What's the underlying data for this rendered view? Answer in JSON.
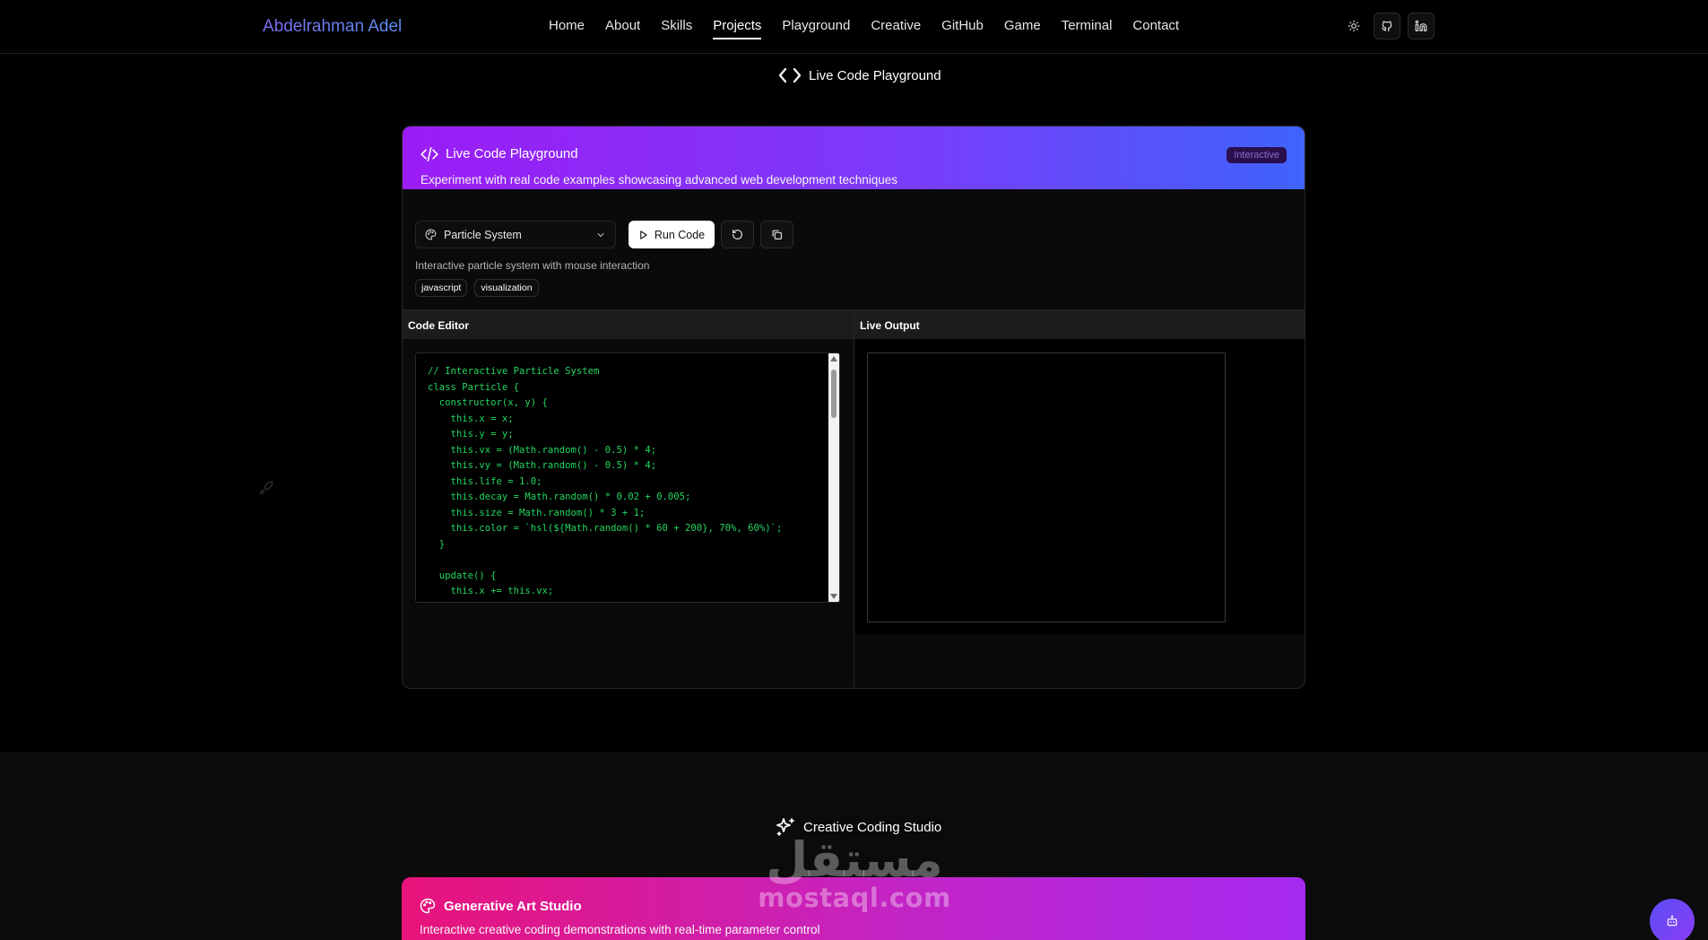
{
  "brand": "Abdelrahman Adel",
  "nav": {
    "links": [
      "Home",
      "About",
      "Skills",
      "Projects",
      "Playground",
      "Creative",
      "GitHub",
      "Game",
      "Terminal",
      "Contact"
    ],
    "active": "Projects"
  },
  "icons": {
    "theme": "sun-icon",
    "github": "github-icon",
    "linkedin": "linkedin-icon"
  },
  "section_heading": "Live Code Playground",
  "playground": {
    "title": "Live Code Playground",
    "subtitle": "Experiment with real code examples showcasing advanced web development techniques",
    "badge": "Interactive",
    "select_value": "Particle System",
    "run_label": "Run Code",
    "description": "Interactive particle system with mouse interaction",
    "tags": [
      "javascript",
      "visualization"
    ],
    "editor_title": "Code Editor",
    "output_title": "Live Output",
    "code": "// Interactive Particle System\nclass Particle {\n  constructor(x, y) {\n    this.x = x;\n    this.y = y;\n    this.vx = (Math.random() - 0.5) * 4;\n    this.vy = (Math.random() - 0.5) * 4;\n    this.life = 1.0;\n    this.decay = Math.random() * 0.02 + 0.005;\n    this.size = Math.random() * 3 + 1;\n    this.color = `hsl(${Math.random() * 60 + 200}, 70%, 60%)`;\n  }\n\n  update() {\n    this.x += this.vx;"
  },
  "creative": {
    "heading": "Creative Coding Studio",
    "card_title": "Generative Art Studio",
    "card_subtitle": "Interactive creative coding demonstrations with real-time parameter control"
  },
  "watermark": {
    "arabic": "مستقل",
    "latin": "mostaql.com"
  },
  "colors": {
    "playground_gradient": [
      "#9b1cf5",
      "#3f63fb"
    ],
    "art_gradient": [
      "#e8137a",
      "#a52af0"
    ],
    "code_green": "#22d65f"
  }
}
